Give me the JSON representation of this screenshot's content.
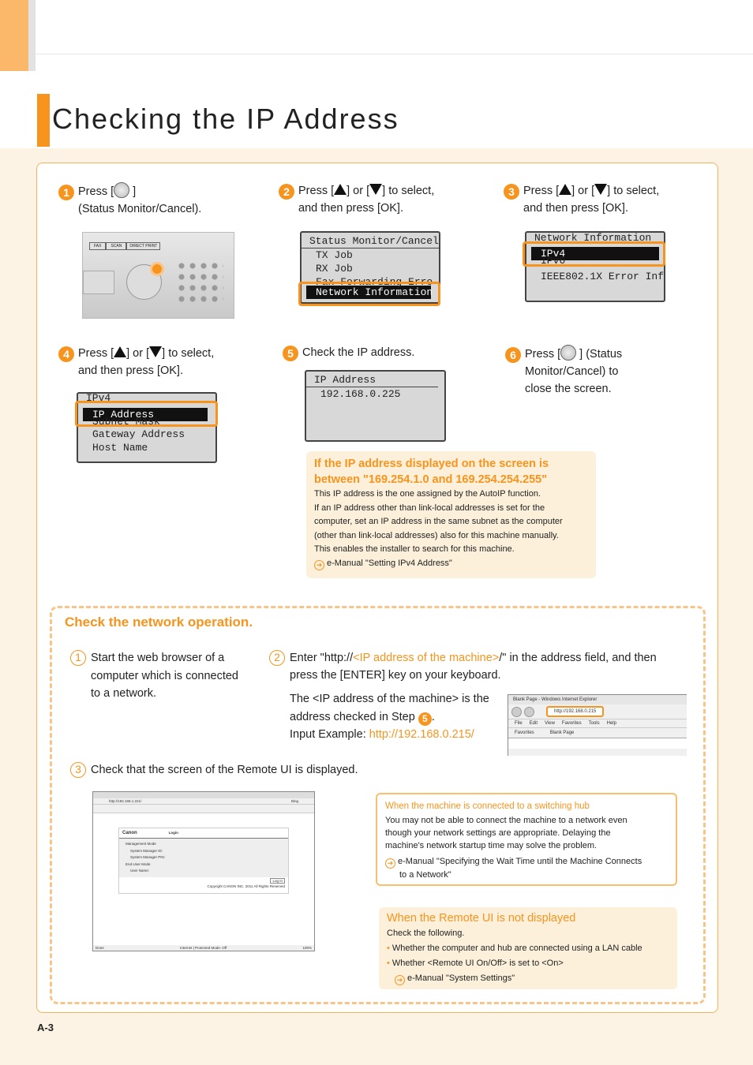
{
  "header": {
    "title": "Checking the IP Address"
  },
  "steps": [
    {
      "num": "1",
      "line1_pre": "Press [",
      "line1_post": "]",
      "line2": "(Status Monitor/Cancel)."
    },
    {
      "num": "2",
      "line1_pre": "Press [",
      "mid": "] or [",
      "line1_post": "] to select,",
      "line2": "and then press [OK]."
    },
    {
      "num": "3",
      "line1_pre": "Press [",
      "mid": "] or [",
      "line1_post": "] to select,",
      "line2": "and then press [OK]."
    },
    {
      "num": "4",
      "line1_pre": "Press [",
      "mid": "] or [",
      "line1_post": "] to select,",
      "line2": "and then press [OK]."
    },
    {
      "num": "5",
      "line1": "Check the IP address."
    },
    {
      "num": "6",
      "line1_pre": "Press [",
      "line1_post": "] (Status",
      "line2": "Monitor/Cancel) to",
      "line3": "close the screen."
    }
  ],
  "panel": {
    "buttons": [
      "FAX",
      "SCAN",
      "DIRECT PRINT"
    ]
  },
  "lcd2": {
    "rows": [
      "Status Monitor/Cancel",
      "TX Job",
      "RX Job",
      "Fax Forwarding Erro",
      "Network Information"
    ]
  },
  "lcd3": {
    "rows": [
      "Network Information",
      "IPv4",
      "IPv6",
      "IEEE802.1X Error Inf…"
    ]
  },
  "lcd4": {
    "rows": [
      "IPv4",
      "IP Address",
      "Subnet Mask",
      "Gateway Address",
      "Host Name"
    ]
  },
  "lcd5": {
    "rows": [
      "IP Address",
      "192.168.0.225"
    ]
  },
  "tip": {
    "title1": "If the IP address displayed on the screen is",
    "title2": "between \"169.254.1.0 and 169.254.254.255\"",
    "lines": [
      "This IP address is the one assigned by the AutoIP function.",
      "If an IP address other than link-local addresses is set for the",
      "computer, set an IP address in the same subnet as the computer",
      "(other than link-local addresses) also for this machine manually.",
      "This enables the installer to search for this machine."
    ],
    "link": "e-Manual \"Setting IPv4 Address\""
  },
  "section": {
    "title": "Check the network operation.",
    "s1": {
      "num": "1",
      "lines": [
        "Start the web browser of a",
        "computer which is connected",
        "to a network."
      ]
    },
    "s2": {
      "num": "2",
      "pre": "Enter \"http://",
      "ph": "<IP address of the machine>",
      "post": "/\" in the address field, and then",
      "line2": "press the [ENTER] key on your keyboard.",
      "p2a": "The <IP address of the machine> is the",
      "p2b": "address checked in Step",
      "p2step": "5",
      "p2end": ".",
      "ex_label": "Input Example:",
      "ex": "http://192.168.0.215/"
    },
    "s3": {
      "num": "3",
      "text": "Check that the screen of the Remote UI is displayed."
    }
  },
  "ie": {
    "title": "Blank Page - Windows Internet Explorer",
    "url": "http://192.168.0.215",
    "menu": [
      "File",
      "Edit",
      "View",
      "Favorites",
      "Tools",
      "Help"
    ],
    "fav": "Favorites",
    "tab": "Blank Page"
  },
  "rui": {
    "url": "http://192.168.1.221/",
    "search": "Bing",
    "brand": "Canon",
    "login": "Login",
    "mgmt": "Management Mode",
    "id": "System Manager ID:",
    "pin": "System Manager PIN:",
    "enduser": "End-User Mode",
    "user": "User Name:",
    "btn": "Log In",
    "copy": "Copyright CANON INC. 2011 All Rights Reserved",
    "status": "Internet | Protected Mode: Off",
    "zoom": "100%",
    "done": "Done"
  },
  "note1": {
    "title": "When the machine is connected to a switching hub",
    "lines": [
      "You may not be able to connect the machine to a network even",
      "though your network settings are appropriate. Delaying the",
      "machine's network startup time may solve the problem."
    ],
    "link1": "e-Manual \"Specifying the Wait Time until the Machine Connects",
    "link2": "to a Network\""
  },
  "note2": {
    "title": "When the Remote UI is not displayed",
    "intro": "Check the following.",
    "bullets": [
      "Whether the computer and hub are connected using a LAN cable",
      "Whether <Remote UI On/Off> is set to <On>"
    ],
    "link": "e-Manual \"System Settings\""
  },
  "footer": {
    "page": "A-3"
  },
  "colors": {
    "accent": "#f7941d",
    "background": "#fdf3e4"
  }
}
